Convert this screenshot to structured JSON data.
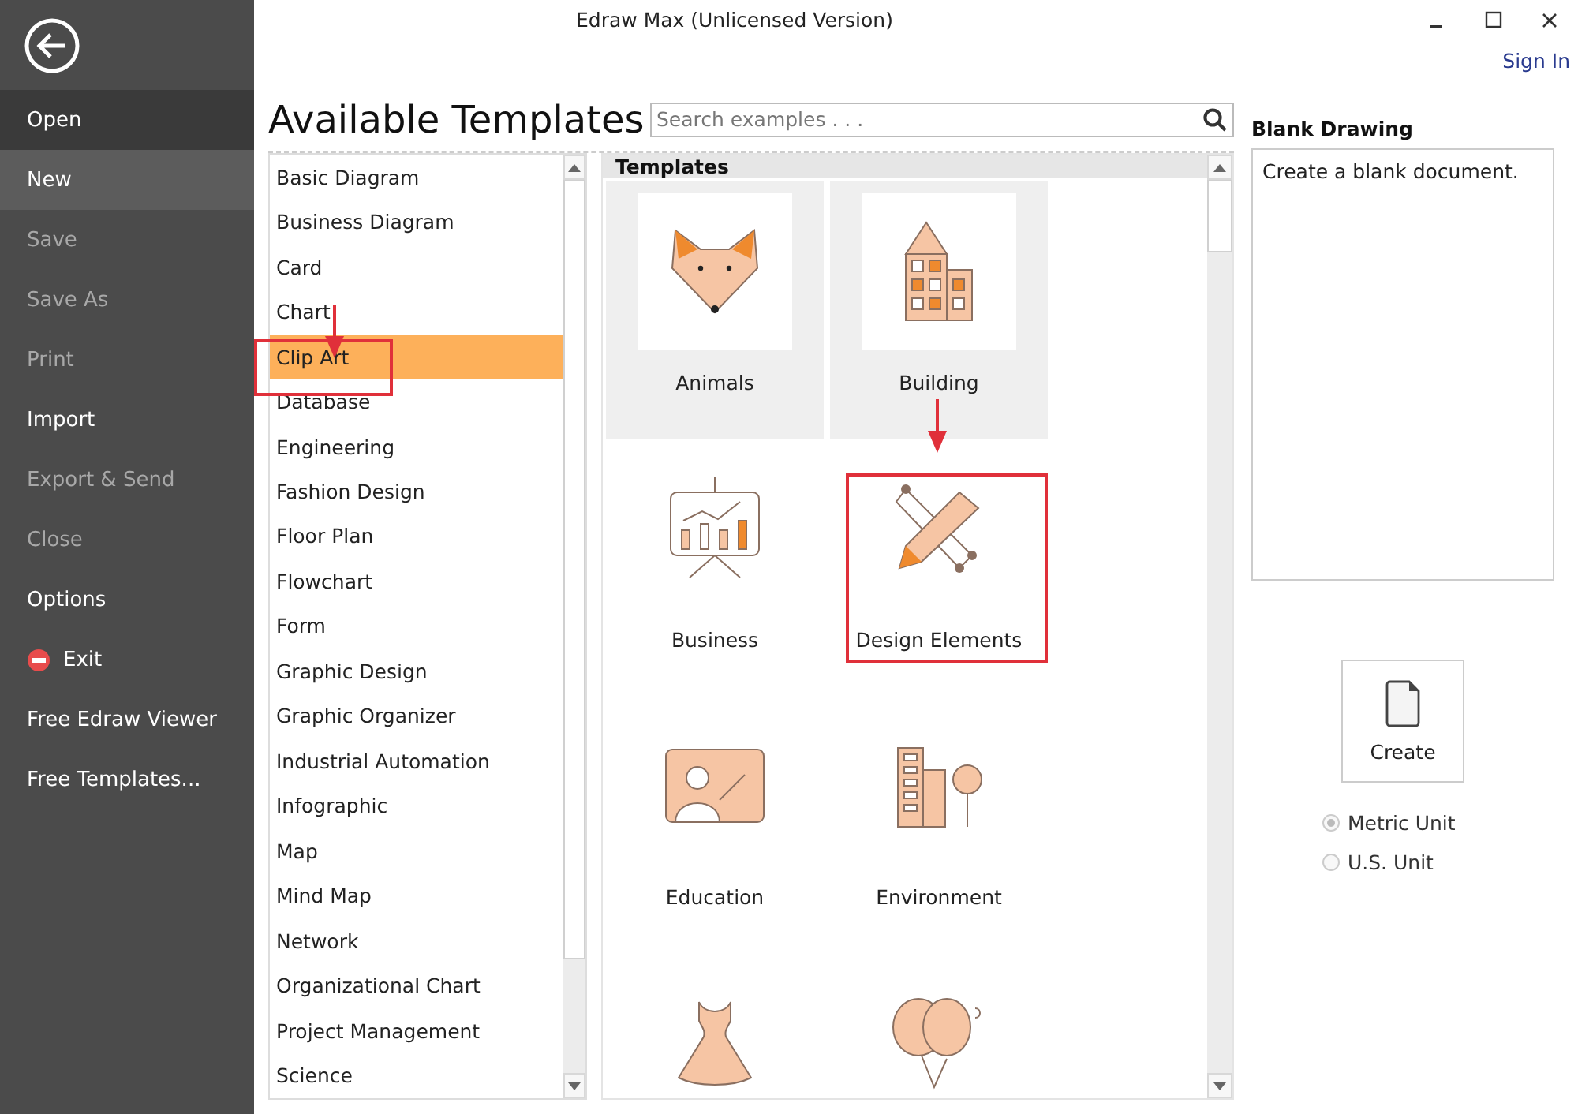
{
  "window": {
    "title": "Edraw Max (Unlicensed Version)",
    "sign_in": "Sign In"
  },
  "sidebar": {
    "items": [
      {
        "label": "Open",
        "kind": "plain",
        "selected": false,
        "hovered": true,
        "disabled": false
      },
      {
        "label": "New",
        "kind": "plain",
        "selected": true,
        "hovered": false,
        "disabled": false
      },
      {
        "label": "Save",
        "kind": "plain",
        "selected": false,
        "hovered": false,
        "disabled": true
      },
      {
        "label": "Save As",
        "kind": "plain",
        "selected": false,
        "hovered": false,
        "disabled": true
      },
      {
        "label": "Print",
        "kind": "plain",
        "selected": false,
        "hovered": false,
        "disabled": true
      },
      {
        "label": "Import",
        "kind": "plain",
        "selected": false,
        "hovered": false,
        "disabled": false
      },
      {
        "label": "Export & Send",
        "kind": "plain",
        "selected": false,
        "hovered": false,
        "disabled": true
      },
      {
        "label": "Close",
        "kind": "plain",
        "selected": false,
        "hovered": false,
        "disabled": true
      },
      {
        "label": "Options",
        "kind": "plain",
        "selected": false,
        "hovered": false,
        "disabled": false
      },
      {
        "label": "Exit",
        "kind": "exit",
        "selected": false,
        "hovered": false,
        "disabled": false
      },
      {
        "label": "Free Edraw Viewer",
        "kind": "plain",
        "selected": false,
        "hovered": false,
        "disabled": false
      },
      {
        "label": "Free Templates...",
        "kind": "plain",
        "selected": false,
        "hovered": false,
        "disabled": false
      }
    ]
  },
  "heading": "Available Templates",
  "search": {
    "placeholder": "Search examples . . ."
  },
  "categories": [
    {
      "label": "Basic Diagram",
      "selected": false,
      "annotated": false
    },
    {
      "label": "Business Diagram",
      "selected": false,
      "annotated": false
    },
    {
      "label": "Card",
      "selected": false,
      "annotated": false
    },
    {
      "label": "Chart",
      "selected": false,
      "annotated": false
    },
    {
      "label": "Clip Art",
      "selected": true,
      "annotated": true
    },
    {
      "label": "Database",
      "selected": false,
      "annotated": false
    },
    {
      "label": "Engineering",
      "selected": false,
      "annotated": false
    },
    {
      "label": "Fashion Design",
      "selected": false,
      "annotated": false
    },
    {
      "label": "Floor Plan",
      "selected": false,
      "annotated": false
    },
    {
      "label": "Flowchart",
      "selected": false,
      "annotated": false
    },
    {
      "label": "Form",
      "selected": false,
      "annotated": false
    },
    {
      "label": "Graphic Design",
      "selected": false,
      "annotated": false
    },
    {
      "label": "Graphic Organizer",
      "selected": false,
      "annotated": false
    },
    {
      "label": "Industrial Automation",
      "selected": false,
      "annotated": false
    },
    {
      "label": "Infographic",
      "selected": false,
      "annotated": false
    },
    {
      "label": "Map",
      "selected": false,
      "annotated": false
    },
    {
      "label": "Mind Map",
      "selected": false,
      "annotated": false
    },
    {
      "label": "Network",
      "selected": false,
      "annotated": false
    },
    {
      "label": "Organizational Chart",
      "selected": false,
      "annotated": false
    },
    {
      "label": "Project Management",
      "selected": false,
      "annotated": false
    },
    {
      "label": "Science",
      "selected": false,
      "annotated": false
    }
  ],
  "templates": {
    "header": "Templates",
    "tiles": [
      {
        "label": "Animals",
        "kind": "fox",
        "highlighted": true,
        "annotated": false
      },
      {
        "label": "Building",
        "kind": "building",
        "highlighted": true,
        "annotated": false
      },
      {
        "label": "Business",
        "kind": "presentation",
        "highlighted": false,
        "annotated": false
      },
      {
        "label": "Design Elements",
        "kind": "pencil",
        "highlighted": false,
        "annotated": true
      },
      {
        "label": "Education",
        "kind": "education",
        "highlighted": false,
        "annotated": false
      },
      {
        "label": "Environment",
        "kind": "environment",
        "highlighted": false,
        "annotated": false
      },
      {
        "kind": "dress",
        "highlighted": false,
        "annotated": false
      },
      {
        "kind": "balloons",
        "highlighted": false,
        "annotated": false
      }
    ]
  },
  "details": {
    "title": "Blank Drawing",
    "description": "Create a blank document.",
    "create": "Create",
    "units": [
      {
        "label": "Metric Unit",
        "selected": true
      },
      {
        "label": "U.S. Unit",
        "selected": false
      }
    ]
  }
}
